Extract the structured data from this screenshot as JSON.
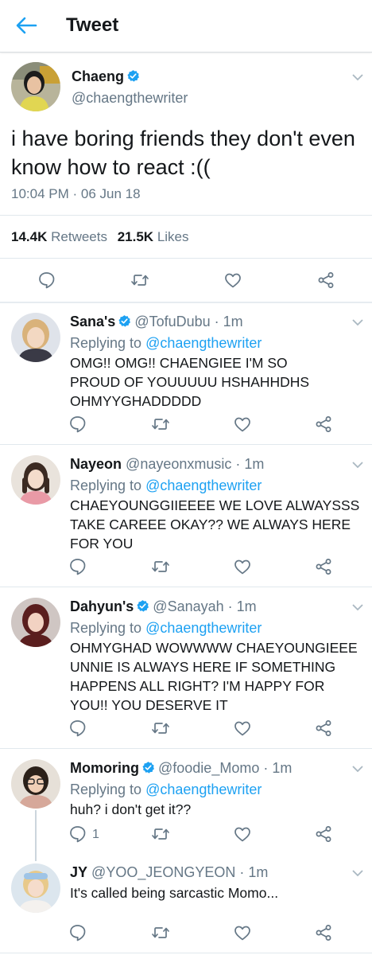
{
  "header": {
    "title": "Tweet"
  },
  "colors": {
    "accent": "#1da1f2",
    "muted": "#657786",
    "text": "#14171a"
  },
  "main_tweet": {
    "name": "Chaeng",
    "handle": "@chaengthewriter",
    "text": "i have boring friends they don't even know how to react :((",
    "timestamp": "10:04 PM · 06 Jun 18",
    "retweets_count": "14.4K",
    "retweets_label": "Retweets",
    "likes_count": "21.5K",
    "likes_label": "Likes"
  },
  "replies": [
    {
      "name": "Sana's",
      "handle": "@TofuDubu · 1m",
      "replying_prefix": "Replying to",
      "replying_to": "@chaengthewriter",
      "text": "OMG!! OMG!! CHAENGIEE I'M SO PROUD OF YOUUUUU HSHAHHDHS OHMYYGHADDDDD",
      "reply_count": ""
    },
    {
      "name": "Nayeon",
      "handle": "@nayeonxmusic · 1m",
      "replying_prefix": "Replying to",
      "replying_to": "@chaengthewriter",
      "text": "CHAEYOUNGGIIEEEE WE LOVE ALWAYSSS TAKE CAREEE OKAY?? WE ALWAYS HERE FOR YOU",
      "reply_count": ""
    },
    {
      "name": "Dahyun's",
      "handle": "@Sanayah · 1m",
      "replying_prefix": "Replying to",
      "replying_to": "@chaengthewriter",
      "text": "OHMYGHAD WOWWWW CHAEYOUNGIEEE UNNIE IS ALWAYS HERE IF SOMETHING HAPPENS ALL RIGHT? I'M HAPPY FOR YOU!! YOU DESERVE IT",
      "reply_count": ""
    },
    {
      "name": "Momoring",
      "handle": "@foodie_Momo · 1m",
      "replying_prefix": "Replying to",
      "replying_to": "@chaengthewriter",
      "text": "huh? i don't get it??",
      "reply_count": "1"
    },
    {
      "name": "JY",
      "handle": "@YOO_JEONGYEON · 1m",
      "text": "It's called being sarcastic Momo...",
      "reply_count": ""
    }
  ],
  "icons": {
    "back": "back-arrow-icon",
    "verified": "verified-badge-icon",
    "reply": "reply-icon",
    "retweet": "retweet-icon",
    "like": "heart-icon",
    "share": "share-icon",
    "menu": "chevron-down-icon"
  }
}
